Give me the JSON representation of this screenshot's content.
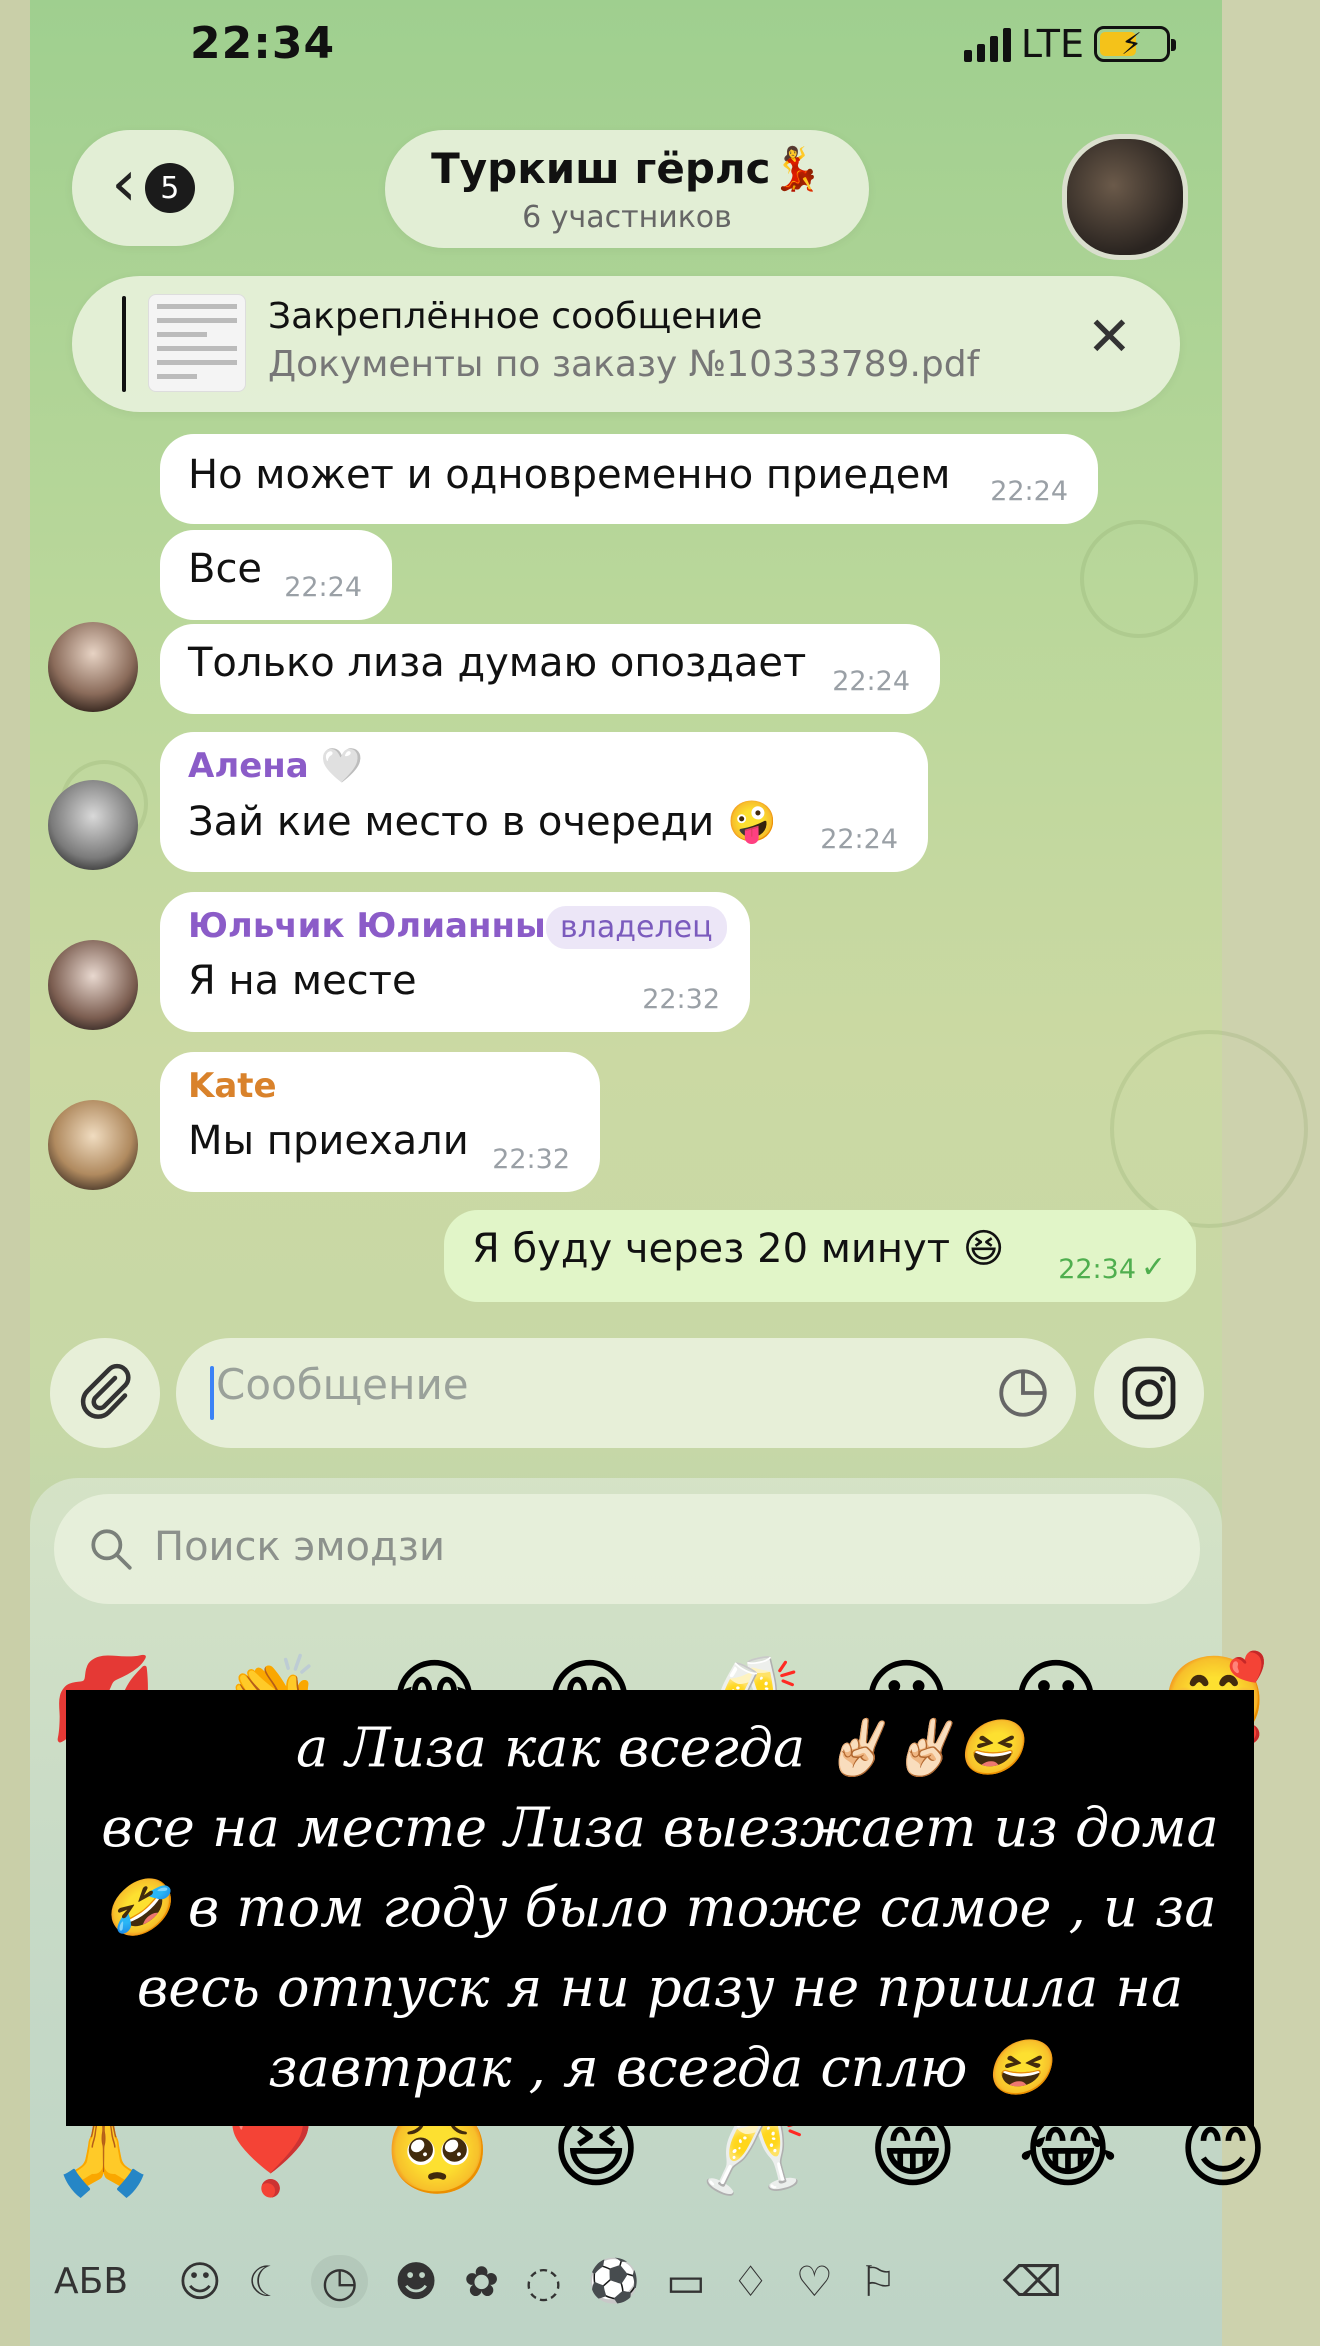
{
  "status_bar": {
    "time": "22:34",
    "network": "LTE",
    "icons": [
      "cellular-signal-icon",
      "battery-charging-icon"
    ]
  },
  "header": {
    "back_count": "5",
    "chat_title": "Туркиш гёрлс💃",
    "chat_subtitle": "6 участников",
    "icons": [
      "chevron-left-icon",
      "group-avatar"
    ]
  },
  "pinned": {
    "title": "Закреплённое сообщение",
    "subtitle": "Документы по заказу №10333789.pdf",
    "close_icon": "close-icon"
  },
  "messages": [
    {
      "text": "Но может и одновременно приедем",
      "time": "22:24"
    },
    {
      "text": "Все",
      "time": "22:24"
    },
    {
      "text": "Только лиза думаю опоздает",
      "time": "22:24"
    },
    {
      "sender": "Алена 🤍",
      "text": "Зай кие место в очереди 🤪",
      "time": "22:24"
    },
    {
      "sender": "Юльчик Юлианны",
      "role": "владелец",
      "text": "Я на месте",
      "time": "22:32"
    },
    {
      "sender": "Kate",
      "text": "Мы приехали",
      "time": "22:32"
    },
    {
      "text": "Я буду через 20 минут 😆",
      "time": "22:34",
      "status": "✓"
    }
  ],
  "colors": {
    "sender_alena": "#8b5cc8",
    "sender_yulchik": "#8b5cc8",
    "sender_kate": "#d9822b",
    "outgoing_bubble": "#e1f5c8",
    "read_check": "#4fae4e"
  },
  "composer": {
    "placeholder": "Сообщение",
    "icons": [
      "attach-icon",
      "sticker-icon",
      "instagram-icon"
    ]
  },
  "keyboard": {
    "search_placeholder": "Поиск эмодзи",
    "emoji_row_top": [
      "💋",
      "👏",
      "😂",
      "😊",
      "🥂",
      "😀",
      "😀",
      "🥰"
    ],
    "emoji_row_bottom": [
      "🙏",
      "❣️",
      "🥺",
      "😆",
      "🥂",
      "😁",
      "😂",
      "😊"
    ],
    "abc_label": "АБВ",
    "tab_icons": [
      "smile-face-icon",
      "moon-icon",
      "clock-icon",
      "emoji-face-icon",
      "animal-icon",
      "food-icon",
      "ball-icon",
      "car-icon",
      "lightbulb-icon",
      "heart-icon",
      "flag-icon",
      "backspace-icon"
    ]
  },
  "story_overlay": {
    "text": "а Лиза как всегда ✌🏻✌🏻😆\nвсе на месте Лиза выезжает из дома 🤣 в том году было тоже самое , и за весь отпуск я ни разу не пришла на завтрак , я всегда сплю 😆"
  }
}
